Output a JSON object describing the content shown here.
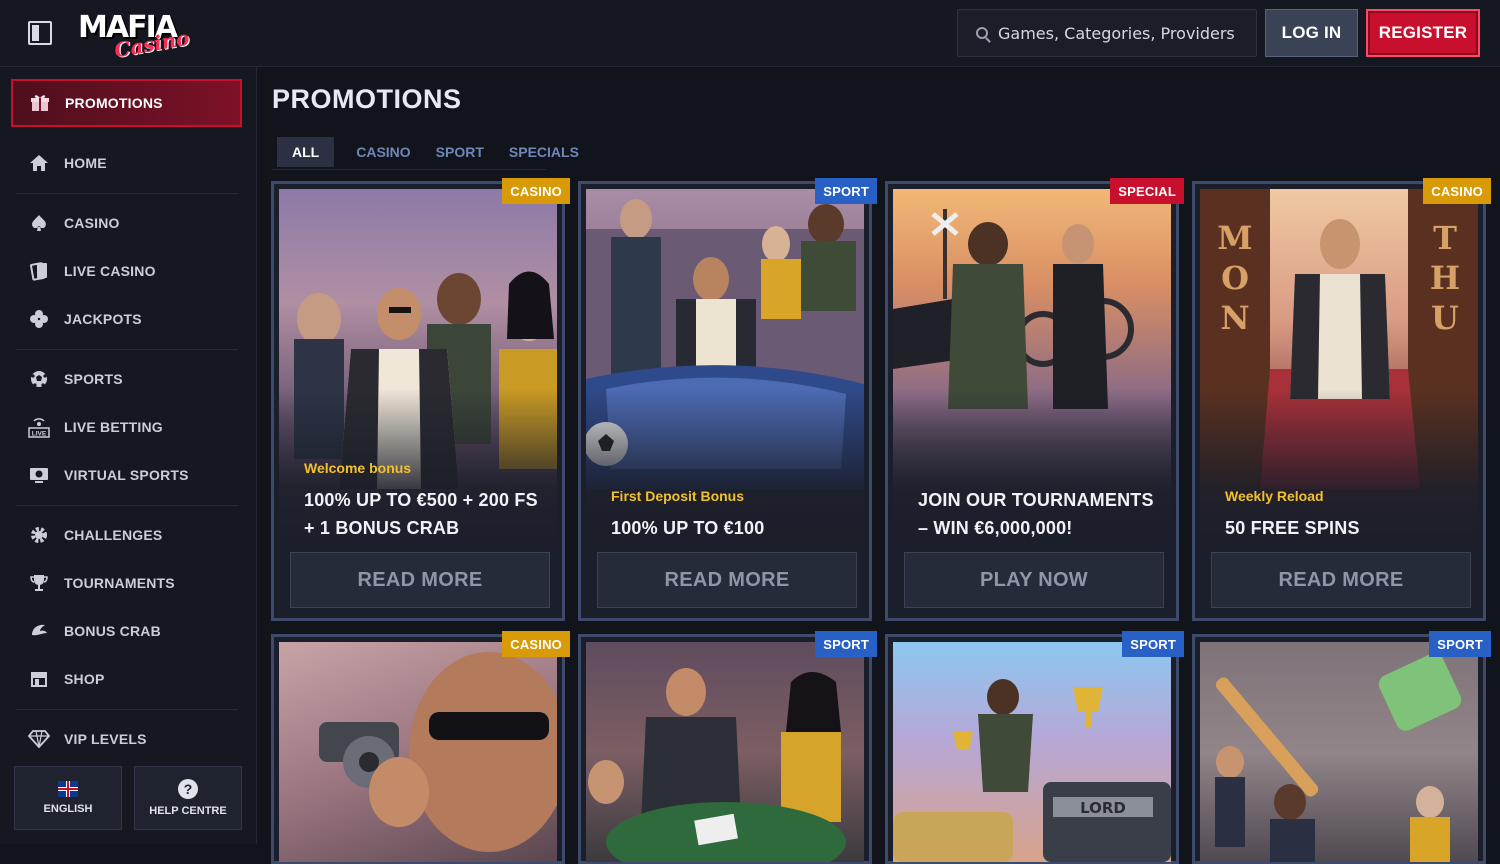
{
  "header": {
    "logo_main": "MAFIA",
    "logo_sub": "Casino",
    "search_placeholder": "Games, Categories, Providers",
    "login_label": "LOG IN",
    "register_label": "REGISTER"
  },
  "sidebar": {
    "promotions": {
      "label": "PROMOTIONS",
      "icon": "gift-icon"
    },
    "items": [
      {
        "label": "HOME",
        "icon": "home-icon"
      },
      {
        "label": "CASINO",
        "icon": "spade-icon"
      },
      {
        "label": "LIVE CASINO",
        "icon": "live-cards-icon"
      },
      {
        "label": "JACKPOTS",
        "icon": "clover-icon"
      },
      {
        "label": "SPORTS",
        "icon": "football-icon"
      },
      {
        "label": "LIVE BETTING",
        "icon": "live-broadcast-icon"
      },
      {
        "label": "VIRTUAL SPORTS",
        "icon": "monitor-icon"
      },
      {
        "label": "CHALLENGES",
        "icon": "gear-badge-icon"
      },
      {
        "label": "TOURNAMENTS",
        "icon": "trophy-icon"
      },
      {
        "label": "BONUS CRAB",
        "icon": "crab-icon"
      },
      {
        "label": "SHOP",
        "icon": "shop-icon"
      },
      {
        "label": "VIP LEVELS",
        "icon": "diamond-icon"
      }
    ],
    "language_label": "ENGLISH",
    "help_label": "HELP CENTRE"
  },
  "main": {
    "title": "PROMOTIONS",
    "tabs": [
      "ALL",
      "CASINO",
      "SPORT",
      "SPECIALS"
    ],
    "active_tab": "ALL",
    "cards": [
      {
        "tag": "CASINO",
        "subtitle": "Welcome bonus",
        "headline": "100% UP TO €500 + 200 FS + 1 BONUS CRAB",
        "cta": "READ MORE"
      },
      {
        "tag": "SPORT",
        "subtitle": "First Deposit Bonus",
        "headline": "100% UP TO €100",
        "cta": "READ MORE"
      },
      {
        "tag": "SPECIAL",
        "subtitle": "",
        "headline": "JOIN OUR TOURNAMENTS – WIN €6,000,000!",
        "cta": "PLAY NOW"
      },
      {
        "tag": "CASINO",
        "subtitle": "Weekly Reload",
        "headline": "50 FREE SPINS",
        "cta": "READ MORE"
      },
      {
        "tag": "CASINO"
      },
      {
        "tag": "SPORT"
      },
      {
        "tag": "SPORT"
      },
      {
        "tag": "SPORT"
      }
    ]
  },
  "colors": {
    "accent_red": "#c8102e",
    "casino_tag": "#d99a07",
    "sport_tag": "#2860c5",
    "subtitle_gold": "#f3c12b"
  }
}
